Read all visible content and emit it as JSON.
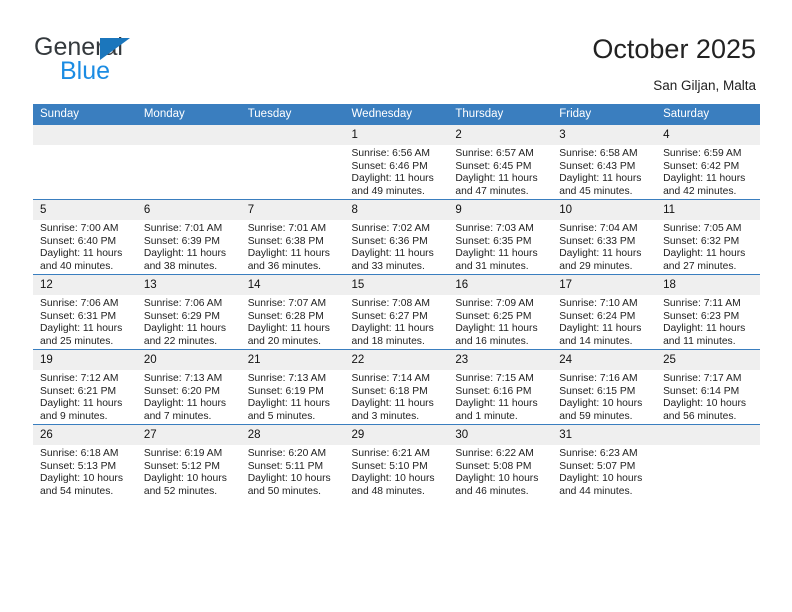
{
  "brand": {
    "name_top": "General",
    "name_bottom": "Blue"
  },
  "header": {
    "title": "October 2025",
    "subtitle": "San Giljan, Malta"
  },
  "colors": {
    "header_blue": "#3a7ebf",
    "logo_blue": "#1b8ce3",
    "logo_triangle": "#1b76bc",
    "daynum_band": "#efefef"
  },
  "weekday_headers": [
    "Sunday",
    "Monday",
    "Tuesday",
    "Wednesday",
    "Thursday",
    "Friday",
    "Saturday"
  ],
  "labels": {
    "sunrise": "Sunrise:",
    "sunset": "Sunset:",
    "daylight": "Daylight:"
  },
  "weeks": [
    [
      {
        "day": "",
        "sunrise": "",
        "sunset": "",
        "daylight_1": "",
        "daylight_2": ""
      },
      {
        "day": "",
        "sunrise": "",
        "sunset": "",
        "daylight_1": "",
        "daylight_2": ""
      },
      {
        "day": "",
        "sunrise": "",
        "sunset": "",
        "daylight_1": "",
        "daylight_2": ""
      },
      {
        "day": "1",
        "sunrise": "Sunrise: 6:56 AM",
        "sunset": "Sunset: 6:46 PM",
        "daylight_1": "Daylight: 11 hours",
        "daylight_2": "and 49 minutes."
      },
      {
        "day": "2",
        "sunrise": "Sunrise: 6:57 AM",
        "sunset": "Sunset: 6:45 PM",
        "daylight_1": "Daylight: 11 hours",
        "daylight_2": "and 47 minutes."
      },
      {
        "day": "3",
        "sunrise": "Sunrise: 6:58 AM",
        "sunset": "Sunset: 6:43 PM",
        "daylight_1": "Daylight: 11 hours",
        "daylight_2": "and 45 minutes."
      },
      {
        "day": "4",
        "sunrise": "Sunrise: 6:59 AM",
        "sunset": "Sunset: 6:42 PM",
        "daylight_1": "Daylight: 11 hours",
        "daylight_2": "and 42 minutes."
      }
    ],
    [
      {
        "day": "5",
        "sunrise": "Sunrise: 7:00 AM",
        "sunset": "Sunset: 6:40 PM",
        "daylight_1": "Daylight: 11 hours",
        "daylight_2": "and 40 minutes."
      },
      {
        "day": "6",
        "sunrise": "Sunrise: 7:01 AM",
        "sunset": "Sunset: 6:39 PM",
        "daylight_1": "Daylight: 11 hours",
        "daylight_2": "and 38 minutes."
      },
      {
        "day": "7",
        "sunrise": "Sunrise: 7:01 AM",
        "sunset": "Sunset: 6:38 PM",
        "daylight_1": "Daylight: 11 hours",
        "daylight_2": "and 36 minutes."
      },
      {
        "day": "8",
        "sunrise": "Sunrise: 7:02 AM",
        "sunset": "Sunset: 6:36 PM",
        "daylight_1": "Daylight: 11 hours",
        "daylight_2": "and 33 minutes."
      },
      {
        "day": "9",
        "sunrise": "Sunrise: 7:03 AM",
        "sunset": "Sunset: 6:35 PM",
        "daylight_1": "Daylight: 11 hours",
        "daylight_2": "and 31 minutes."
      },
      {
        "day": "10",
        "sunrise": "Sunrise: 7:04 AM",
        "sunset": "Sunset: 6:33 PM",
        "daylight_1": "Daylight: 11 hours",
        "daylight_2": "and 29 minutes."
      },
      {
        "day": "11",
        "sunrise": "Sunrise: 7:05 AM",
        "sunset": "Sunset: 6:32 PM",
        "daylight_1": "Daylight: 11 hours",
        "daylight_2": "and 27 minutes."
      }
    ],
    [
      {
        "day": "12",
        "sunrise": "Sunrise: 7:06 AM",
        "sunset": "Sunset: 6:31 PM",
        "daylight_1": "Daylight: 11 hours",
        "daylight_2": "and 25 minutes."
      },
      {
        "day": "13",
        "sunrise": "Sunrise: 7:06 AM",
        "sunset": "Sunset: 6:29 PM",
        "daylight_1": "Daylight: 11 hours",
        "daylight_2": "and 22 minutes."
      },
      {
        "day": "14",
        "sunrise": "Sunrise: 7:07 AM",
        "sunset": "Sunset: 6:28 PM",
        "daylight_1": "Daylight: 11 hours",
        "daylight_2": "and 20 minutes."
      },
      {
        "day": "15",
        "sunrise": "Sunrise: 7:08 AM",
        "sunset": "Sunset: 6:27 PM",
        "daylight_1": "Daylight: 11 hours",
        "daylight_2": "and 18 minutes."
      },
      {
        "day": "16",
        "sunrise": "Sunrise: 7:09 AM",
        "sunset": "Sunset: 6:25 PM",
        "daylight_1": "Daylight: 11 hours",
        "daylight_2": "and 16 minutes."
      },
      {
        "day": "17",
        "sunrise": "Sunrise: 7:10 AM",
        "sunset": "Sunset: 6:24 PM",
        "daylight_1": "Daylight: 11 hours",
        "daylight_2": "and 14 minutes."
      },
      {
        "day": "18",
        "sunrise": "Sunrise: 7:11 AM",
        "sunset": "Sunset: 6:23 PM",
        "daylight_1": "Daylight: 11 hours",
        "daylight_2": "and 11 minutes."
      }
    ],
    [
      {
        "day": "19",
        "sunrise": "Sunrise: 7:12 AM",
        "sunset": "Sunset: 6:21 PM",
        "daylight_1": "Daylight: 11 hours",
        "daylight_2": "and 9 minutes."
      },
      {
        "day": "20",
        "sunrise": "Sunrise: 7:13 AM",
        "sunset": "Sunset: 6:20 PM",
        "daylight_1": "Daylight: 11 hours",
        "daylight_2": "and 7 minutes."
      },
      {
        "day": "21",
        "sunrise": "Sunrise: 7:13 AM",
        "sunset": "Sunset: 6:19 PM",
        "daylight_1": "Daylight: 11 hours",
        "daylight_2": "and 5 minutes."
      },
      {
        "day": "22",
        "sunrise": "Sunrise: 7:14 AM",
        "sunset": "Sunset: 6:18 PM",
        "daylight_1": "Daylight: 11 hours",
        "daylight_2": "and 3 minutes."
      },
      {
        "day": "23",
        "sunrise": "Sunrise: 7:15 AM",
        "sunset": "Sunset: 6:16 PM",
        "daylight_1": "Daylight: 11 hours",
        "daylight_2": "and 1 minute."
      },
      {
        "day": "24",
        "sunrise": "Sunrise: 7:16 AM",
        "sunset": "Sunset: 6:15 PM",
        "daylight_1": "Daylight: 10 hours",
        "daylight_2": "and 59 minutes."
      },
      {
        "day": "25",
        "sunrise": "Sunrise: 7:17 AM",
        "sunset": "Sunset: 6:14 PM",
        "daylight_1": "Daylight: 10 hours",
        "daylight_2": "and 56 minutes."
      }
    ],
    [
      {
        "day": "26",
        "sunrise": "Sunrise: 6:18 AM",
        "sunset": "Sunset: 5:13 PM",
        "daylight_1": "Daylight: 10 hours",
        "daylight_2": "and 54 minutes."
      },
      {
        "day": "27",
        "sunrise": "Sunrise: 6:19 AM",
        "sunset": "Sunset: 5:12 PM",
        "daylight_1": "Daylight: 10 hours",
        "daylight_2": "and 52 minutes."
      },
      {
        "day": "28",
        "sunrise": "Sunrise: 6:20 AM",
        "sunset": "Sunset: 5:11 PM",
        "daylight_1": "Daylight: 10 hours",
        "daylight_2": "and 50 minutes."
      },
      {
        "day": "29",
        "sunrise": "Sunrise: 6:21 AM",
        "sunset": "Sunset: 5:10 PM",
        "daylight_1": "Daylight: 10 hours",
        "daylight_2": "and 48 minutes."
      },
      {
        "day": "30",
        "sunrise": "Sunrise: 6:22 AM",
        "sunset": "Sunset: 5:08 PM",
        "daylight_1": "Daylight: 10 hours",
        "daylight_2": "and 46 minutes."
      },
      {
        "day": "31",
        "sunrise": "Sunrise: 6:23 AM",
        "sunset": "Sunset: 5:07 PM",
        "daylight_1": "Daylight: 10 hours",
        "daylight_2": "and 44 minutes."
      },
      {
        "day": "",
        "sunrise": "",
        "sunset": "",
        "daylight_1": "",
        "daylight_2": ""
      }
    ]
  ]
}
